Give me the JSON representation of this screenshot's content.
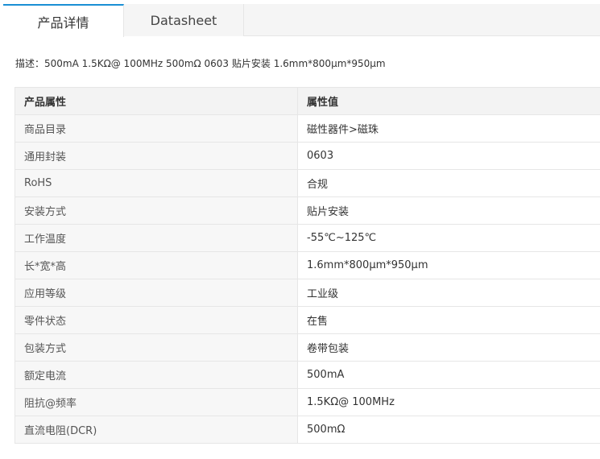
{
  "tabs": [
    {
      "label": "产品详情",
      "active": true
    },
    {
      "label": "Datasheet",
      "active": false
    }
  ],
  "description": "描述：500mA 1.5KΩ@ 100MHz 500mΩ 0603 贴片安装 1.6mm*800μm*950μm",
  "table": {
    "headers": [
      "产品属性",
      "属性值"
    ],
    "rows": [
      [
        "商品目录",
        "磁性器件>磁珠"
      ],
      [
        "通用封装",
        "0603"
      ],
      [
        "RoHS",
        "合规"
      ],
      [
        "安装方式",
        "贴片安装"
      ],
      [
        "工作温度",
        "-55℃~125℃"
      ],
      [
        "长*宽*高",
        "1.6mm*800μm*950μm"
      ],
      [
        "应用等级",
        "工业级"
      ],
      [
        "零件状态",
        "在售"
      ],
      [
        "包装方式",
        "卷带包装"
      ],
      [
        "额定电流",
        "500mA"
      ],
      [
        "阻抗@频率",
        "1.5KΩ@ 100MHz"
      ],
      [
        "直流电阻(DCR)",
        "500mΩ"
      ]
    ]
  },
  "colors": {
    "active_tab_accent": "#1a8fd4",
    "border": "#e6e6e6",
    "header_bg": "#f3f3f3",
    "key_bg": "#f7f7f7"
  }
}
